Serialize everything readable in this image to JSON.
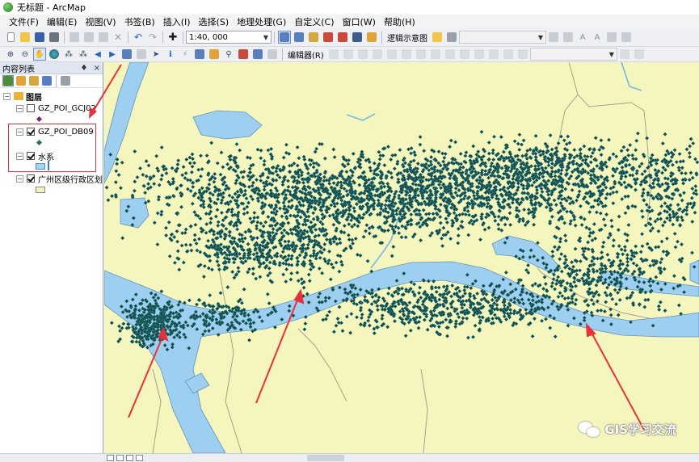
{
  "window": {
    "title": "无标题 - ArcMap"
  },
  "menu": [
    "文件(F)",
    "编辑(E)",
    "视图(V)",
    "书签(B)",
    "插入(I)",
    "选择(S)",
    "地理处理(G)",
    "自定义(C)",
    "窗口(W)",
    "帮助(H)"
  ],
  "toolbar": {
    "scale_value": "1:40, 000",
    "layout_label": "逻辑示意图",
    "editor_label": "编辑器(R)"
  },
  "toc": {
    "title": "内容列表",
    "pin_glyph": "♦",
    "close_glyph": "×",
    "root": "图层",
    "layers": [
      {
        "name": "GZ_POI_GCJ02",
        "checked": false,
        "symbol_color": "#7b2a5e"
      },
      {
        "name": "GZ_POI_DB09",
        "checked": true,
        "symbol_color": "#2b6f6a"
      },
      {
        "name": "水系",
        "checked": true,
        "symbol_color": "#a3d4f5"
      },
      {
        "name": "广州区级行政区划",
        "checked": true,
        "symbol_color": "#f2f2c2"
      }
    ]
  },
  "map": {
    "land_color": "#f5f5be",
    "water_color": "#9fcff0",
    "poi_color": "#16484b",
    "annotation_color": "#e8313a"
  },
  "watermark": {
    "text": "GIS学习交流"
  },
  "icons": [
    "app-icon",
    "new-icon",
    "open-icon",
    "save-icon",
    "print-icon",
    "cut-icon",
    "copy-icon",
    "paste-icon",
    "delete-icon",
    "undo-icon",
    "redo-icon",
    "add-data-icon",
    "zoom-in-icon",
    "zoom-out-icon",
    "pan-icon",
    "full-extent-icon",
    "identify-icon",
    "find-icon",
    "measure-icon",
    "select-icon",
    "wechat-icon"
  ]
}
